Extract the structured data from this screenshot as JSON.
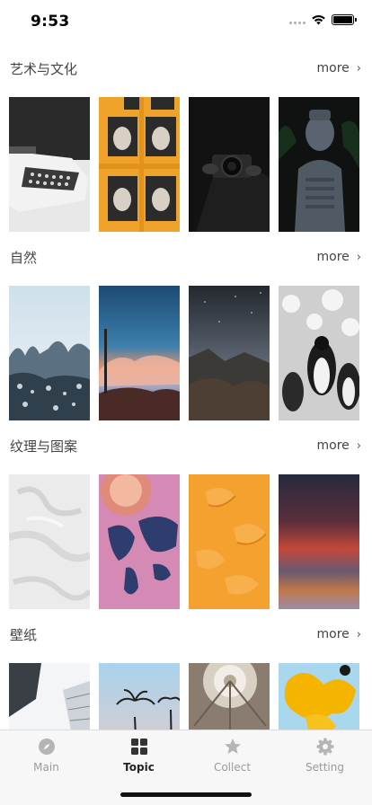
{
  "status": {
    "time": "9:53"
  },
  "sections": [
    {
      "title": "艺术与文化",
      "more": "more"
    },
    {
      "title": "自然",
      "more": "more"
    },
    {
      "title": "纹理与图案",
      "more": "more"
    },
    {
      "title": "壁纸",
      "more": "more"
    }
  ],
  "tabs": [
    {
      "label": "Main",
      "icon": "compass-icon"
    },
    {
      "label": "Topic",
      "icon": "grid-icon",
      "active": true
    },
    {
      "label": "Collect",
      "icon": "star-icon"
    },
    {
      "label": "Setting",
      "icon": "gear-icon"
    }
  ]
}
